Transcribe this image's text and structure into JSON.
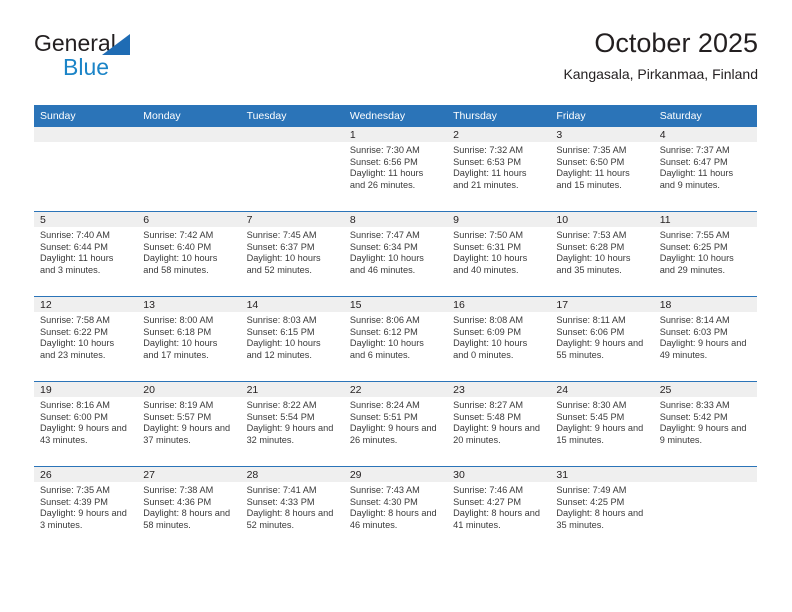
{
  "logo": {
    "word_one": "General",
    "word_two": "Blue",
    "triangle_color": "#1f6cb4",
    "blue_color": "#1b84c7"
  },
  "header": {
    "title": "October 2025",
    "subtitle": "Kangasala, Pirkanmaa, Finland"
  },
  "theme": {
    "header_blue": "#2b74b8",
    "daynum_band": "#efefef",
    "text": "#231f20",
    "detail_text": "#3a3a3a"
  },
  "calendar": {
    "weekday_headers": [
      "Sunday",
      "Monday",
      "Tuesday",
      "Wednesday",
      "Thursday",
      "Friday",
      "Saturday"
    ],
    "weeks": [
      [
        {
          "day": "",
          "blank": true
        },
        {
          "day": "",
          "blank": true
        },
        {
          "day": "",
          "blank": true
        },
        {
          "day": "1",
          "sunrise": "Sunrise: 7:30 AM",
          "sunset": "Sunset: 6:56 PM",
          "daylight": "Daylight: 11 hours and 26 minutes."
        },
        {
          "day": "2",
          "sunrise": "Sunrise: 7:32 AM",
          "sunset": "Sunset: 6:53 PM",
          "daylight": "Daylight: 11 hours and 21 minutes."
        },
        {
          "day": "3",
          "sunrise": "Sunrise: 7:35 AM",
          "sunset": "Sunset: 6:50 PM",
          "daylight": "Daylight: 11 hours and 15 minutes."
        },
        {
          "day": "4",
          "sunrise": "Sunrise: 7:37 AM",
          "sunset": "Sunset: 6:47 PM",
          "daylight": "Daylight: 11 hours and 9 minutes."
        }
      ],
      [
        {
          "day": "5",
          "sunrise": "Sunrise: 7:40 AM",
          "sunset": "Sunset: 6:44 PM",
          "daylight": "Daylight: 11 hours and 3 minutes."
        },
        {
          "day": "6",
          "sunrise": "Sunrise: 7:42 AM",
          "sunset": "Sunset: 6:40 PM",
          "daylight": "Daylight: 10 hours and 58 minutes."
        },
        {
          "day": "7",
          "sunrise": "Sunrise: 7:45 AM",
          "sunset": "Sunset: 6:37 PM",
          "daylight": "Daylight: 10 hours and 52 minutes."
        },
        {
          "day": "8",
          "sunrise": "Sunrise: 7:47 AM",
          "sunset": "Sunset: 6:34 PM",
          "daylight": "Daylight: 10 hours and 46 minutes."
        },
        {
          "day": "9",
          "sunrise": "Sunrise: 7:50 AM",
          "sunset": "Sunset: 6:31 PM",
          "daylight": "Daylight: 10 hours and 40 minutes."
        },
        {
          "day": "10",
          "sunrise": "Sunrise: 7:53 AM",
          "sunset": "Sunset: 6:28 PM",
          "daylight": "Daylight: 10 hours and 35 minutes."
        },
        {
          "day": "11",
          "sunrise": "Sunrise: 7:55 AM",
          "sunset": "Sunset: 6:25 PM",
          "daylight": "Daylight: 10 hours and 29 minutes."
        }
      ],
      [
        {
          "day": "12",
          "sunrise": "Sunrise: 7:58 AM",
          "sunset": "Sunset: 6:22 PM",
          "daylight": "Daylight: 10 hours and 23 minutes."
        },
        {
          "day": "13",
          "sunrise": "Sunrise: 8:00 AM",
          "sunset": "Sunset: 6:18 PM",
          "daylight": "Daylight: 10 hours and 17 minutes."
        },
        {
          "day": "14",
          "sunrise": "Sunrise: 8:03 AM",
          "sunset": "Sunset: 6:15 PM",
          "daylight": "Daylight: 10 hours and 12 minutes."
        },
        {
          "day": "15",
          "sunrise": "Sunrise: 8:06 AM",
          "sunset": "Sunset: 6:12 PM",
          "daylight": "Daylight: 10 hours and 6 minutes."
        },
        {
          "day": "16",
          "sunrise": "Sunrise: 8:08 AM",
          "sunset": "Sunset: 6:09 PM",
          "daylight": "Daylight: 10 hours and 0 minutes."
        },
        {
          "day": "17",
          "sunrise": "Sunrise: 8:11 AM",
          "sunset": "Sunset: 6:06 PM",
          "daylight": "Daylight: 9 hours and 55 minutes."
        },
        {
          "day": "18",
          "sunrise": "Sunrise: 8:14 AM",
          "sunset": "Sunset: 6:03 PM",
          "daylight": "Daylight: 9 hours and 49 minutes."
        }
      ],
      [
        {
          "day": "19",
          "sunrise": "Sunrise: 8:16 AM",
          "sunset": "Sunset: 6:00 PM",
          "daylight": "Daylight: 9 hours and 43 minutes."
        },
        {
          "day": "20",
          "sunrise": "Sunrise: 8:19 AM",
          "sunset": "Sunset: 5:57 PM",
          "daylight": "Daylight: 9 hours and 37 minutes."
        },
        {
          "day": "21",
          "sunrise": "Sunrise: 8:22 AM",
          "sunset": "Sunset: 5:54 PM",
          "daylight": "Daylight: 9 hours and 32 minutes."
        },
        {
          "day": "22",
          "sunrise": "Sunrise: 8:24 AM",
          "sunset": "Sunset: 5:51 PM",
          "daylight": "Daylight: 9 hours and 26 minutes."
        },
        {
          "day": "23",
          "sunrise": "Sunrise: 8:27 AM",
          "sunset": "Sunset: 5:48 PM",
          "daylight": "Daylight: 9 hours and 20 minutes."
        },
        {
          "day": "24",
          "sunrise": "Sunrise: 8:30 AM",
          "sunset": "Sunset: 5:45 PM",
          "daylight": "Daylight: 9 hours and 15 minutes."
        },
        {
          "day": "25",
          "sunrise": "Sunrise: 8:33 AM",
          "sunset": "Sunset: 5:42 PM",
          "daylight": "Daylight: 9 hours and 9 minutes."
        }
      ],
      [
        {
          "day": "26",
          "sunrise": "Sunrise: 7:35 AM",
          "sunset": "Sunset: 4:39 PM",
          "daylight": "Daylight: 9 hours and 3 minutes."
        },
        {
          "day": "27",
          "sunrise": "Sunrise: 7:38 AM",
          "sunset": "Sunset: 4:36 PM",
          "daylight": "Daylight: 8 hours and 58 minutes."
        },
        {
          "day": "28",
          "sunrise": "Sunrise: 7:41 AM",
          "sunset": "Sunset: 4:33 PM",
          "daylight": "Daylight: 8 hours and 52 minutes."
        },
        {
          "day": "29",
          "sunrise": "Sunrise: 7:43 AM",
          "sunset": "Sunset: 4:30 PM",
          "daylight": "Daylight: 8 hours and 46 minutes."
        },
        {
          "day": "30",
          "sunrise": "Sunrise: 7:46 AM",
          "sunset": "Sunset: 4:27 PM",
          "daylight": "Daylight: 8 hours and 41 minutes."
        },
        {
          "day": "31",
          "sunrise": "Sunrise: 7:49 AM",
          "sunset": "Sunset: 4:25 PM",
          "daylight": "Daylight: 8 hours and 35 minutes."
        },
        {
          "day": "",
          "blank": true
        }
      ]
    ]
  }
}
